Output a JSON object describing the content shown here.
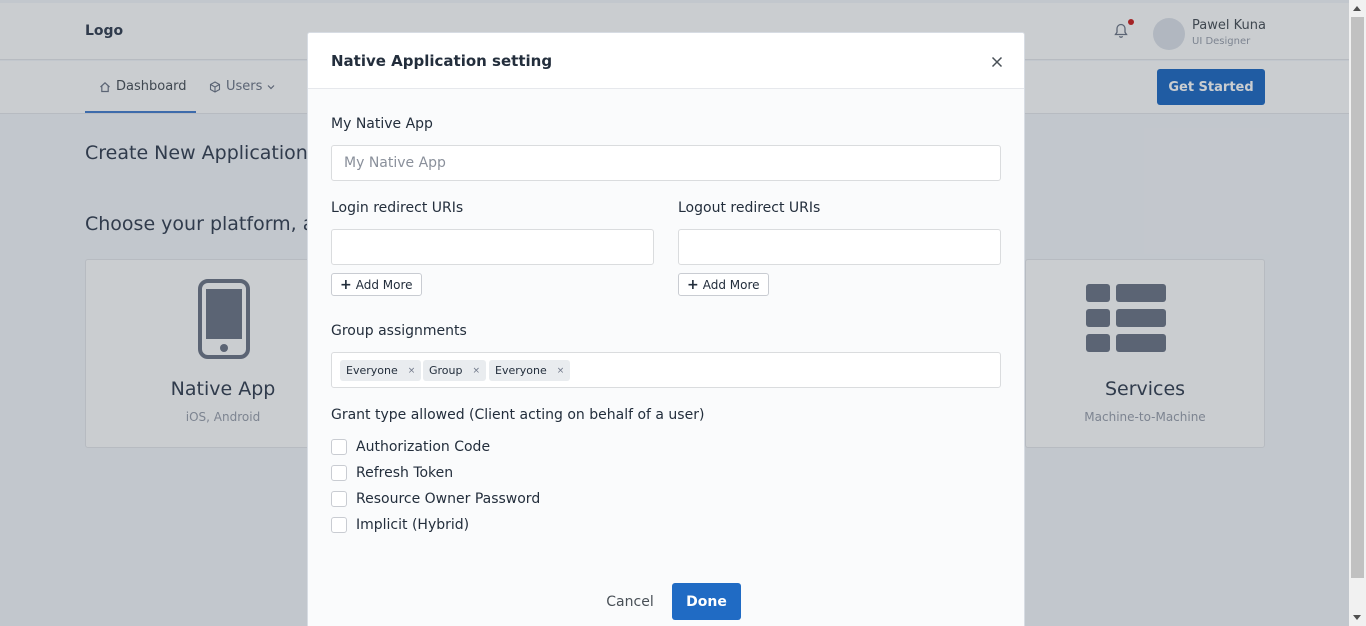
{
  "background": {
    "logo": "Logo",
    "user": {
      "name": "Pawel Kuna",
      "role": "UI Designer"
    },
    "nav": [
      {
        "label": "Dashboard"
      },
      {
        "label": "Users"
      }
    ],
    "get_started_label": "Get Started",
    "page_title": "Create New Application",
    "page_subtitle": "Choose your platform, an",
    "cards": [
      {
        "title": "Native App",
        "subtitle": "iOS, Android"
      },
      {
        "title": "Services",
        "subtitle": "Machine-to-Machine"
      }
    ]
  },
  "modal": {
    "title": "Native Application setting",
    "app_name": {
      "label": "My Native App",
      "placeholder": "My Native App"
    },
    "login_redirect": {
      "label": "Login redirect URIs",
      "add_more": "Add More"
    },
    "logout_redirect": {
      "label": "Logout redirect URIs",
      "add_more": "Add More"
    },
    "group_assignments": {
      "label": "Group assignments",
      "tags": [
        "Everyone",
        "Group",
        "Everyone"
      ],
      "remove_symbol": "×"
    },
    "grant_types": {
      "label": "Grant type allowed (Client acting on behalf of a user)",
      "options": [
        {
          "label": "Authorization Code",
          "checked": false
        },
        {
          "label": "Refresh Token",
          "checked": false
        },
        {
          "label": "Resource Owner Password",
          "checked": false
        },
        {
          "label": "Implicit (Hybrid)",
          "checked": false
        }
      ]
    },
    "cancel_label": "Cancel",
    "done_label": "Done"
  },
  "colors": {
    "primary": "#206bc4",
    "notification_dot": "#cd201f"
  }
}
